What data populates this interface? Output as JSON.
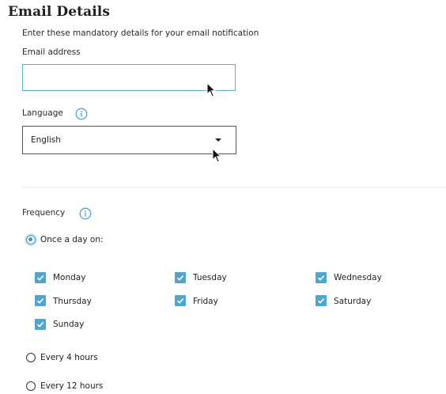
{
  "section": {
    "title": "Email Details",
    "subtitle": "Enter these mandatory details for your email notification"
  },
  "email": {
    "label": "Email address",
    "value": "",
    "placeholder": ""
  },
  "language": {
    "label": "Language",
    "selected": "English"
  },
  "frequency": {
    "label": "Frequency",
    "options": [
      {
        "label": "Once a day on:",
        "selected": true
      },
      {
        "label": "Every 4 hours",
        "selected": false
      },
      {
        "label": "Every 12 hours",
        "selected": false
      }
    ],
    "days": [
      {
        "label": "Monday",
        "checked": true
      },
      {
        "label": "Tuesday",
        "checked": true
      },
      {
        "label": "Wednesday",
        "checked": true
      },
      {
        "label": "Thursday",
        "checked": true
      },
      {
        "label": "Friday",
        "checked": true
      },
      {
        "label": "Saturday",
        "checked": true
      },
      {
        "label": "Sunday",
        "checked": true
      }
    ]
  },
  "colors": {
    "accent": "#4fa6cc",
    "input_border": "#5fb3c8",
    "radio_selected": "#4a8fc1",
    "divider": "#e6e6e6"
  },
  "icons": [
    "info-icon",
    "chevron-down-icon",
    "checkmark-icon",
    "mouse-pointer-icon"
  ]
}
